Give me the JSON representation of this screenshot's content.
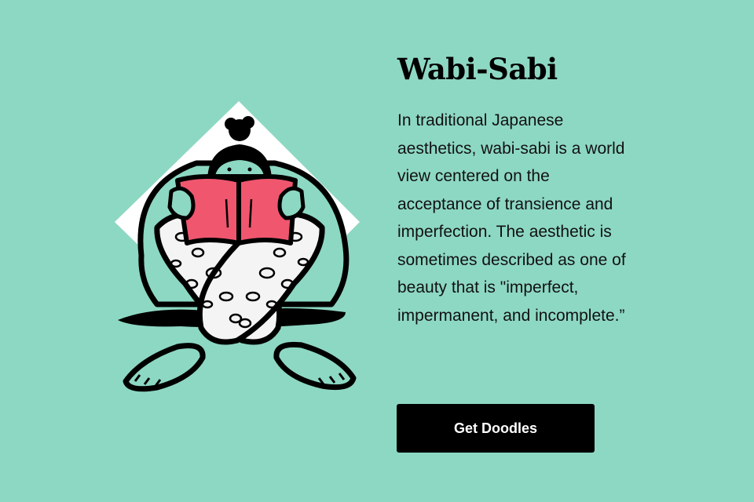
{
  "colors": {
    "background": "#8dd8c3",
    "diamond": "#ffffff",
    "book": "#f0566e",
    "ink": "#000000",
    "button_bg": "#000000",
    "button_text": "#ffffff"
  },
  "illustration": {
    "icon": "doodle-person-reading-book"
  },
  "content": {
    "title": "Wabi-Sabi",
    "description": "In traditional Japanese aesthetics, wabi-sabi is a world view centered on the acceptance of transience and imperfection. The aesthetic is sometimes described as one of beauty that is \"imperfect, impermanent, and incomplete.”",
    "button_label": "Get Doodles"
  }
}
